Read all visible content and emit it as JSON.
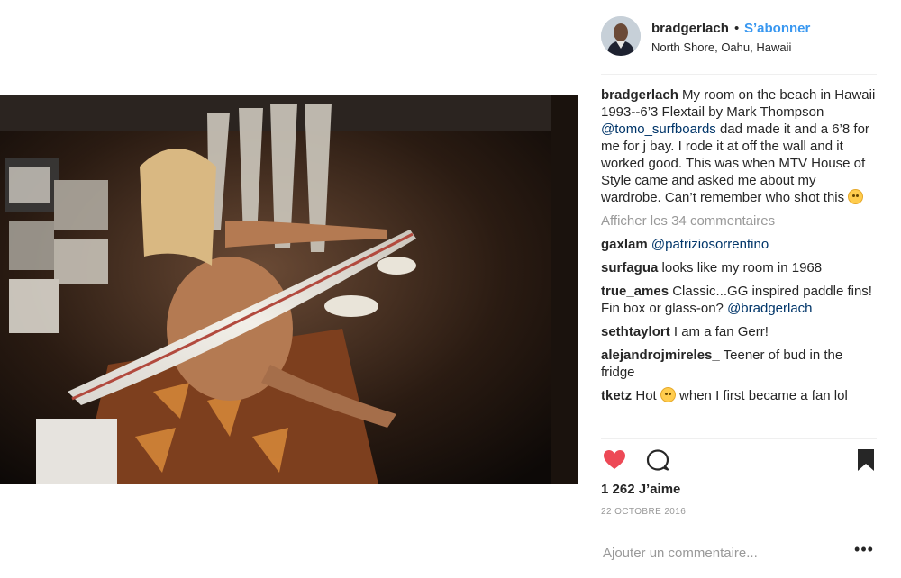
{
  "post": {
    "username": "bradgerlach",
    "separator": "•",
    "follow_label": "S’abonner",
    "location": "North Shore, Oahu, Hawaii",
    "avatar": "profile-avatar"
  },
  "caption": {
    "username": "bradgerlach",
    "text_1": " My room on the beach in Hawaii 1993--6’3 Flextail by Mark Thompson ",
    "mention": "@tomo_surfboards",
    "text_2": " dad made it and a 6’8 for me for j bay. I rode it at off the wall and it worked good. This was when MTV House of Style came and asked me about my wardrobe. Can’t remember who shot this ",
    "emoji": "grimacing-emoji"
  },
  "view_comments": "Afficher les 34 commentaires",
  "comments": [
    {
      "user": "gaxlam",
      "mention": "@patriziosorrentino",
      "text": ""
    },
    {
      "user": "surfagua",
      "mention": "",
      "text": " looks like my room in 1968"
    },
    {
      "user": "true_ames",
      "text": " Classic...GG inspired paddle fins! Fin box or glass-on? ",
      "mention": "@bradgerlach"
    },
    {
      "user": "sethtaylort",
      "mention": "",
      "text": " I am a fan Gerr!"
    },
    {
      "user": "alejandrojmireles_",
      "mention": "",
      "text": " Teener of bud in the fridge"
    },
    {
      "user": "tketz",
      "text_1": " Hot ",
      "emoji": "relieved-emoji",
      "text_2": " when I first became a fan lol"
    }
  ],
  "actions": {
    "like_icon": "heart-icon",
    "comment_icon": "comment-icon",
    "save_icon": "bookmark-icon",
    "like_color": "#ed4956"
  },
  "likes_text": "1 262 J’aime",
  "date": "22 OCTOBRE 2016",
  "add_comment_placeholder": "Ajouter un commentaire...",
  "more_options": "•••",
  "photo": {
    "description_icon": "surfer-photo"
  }
}
